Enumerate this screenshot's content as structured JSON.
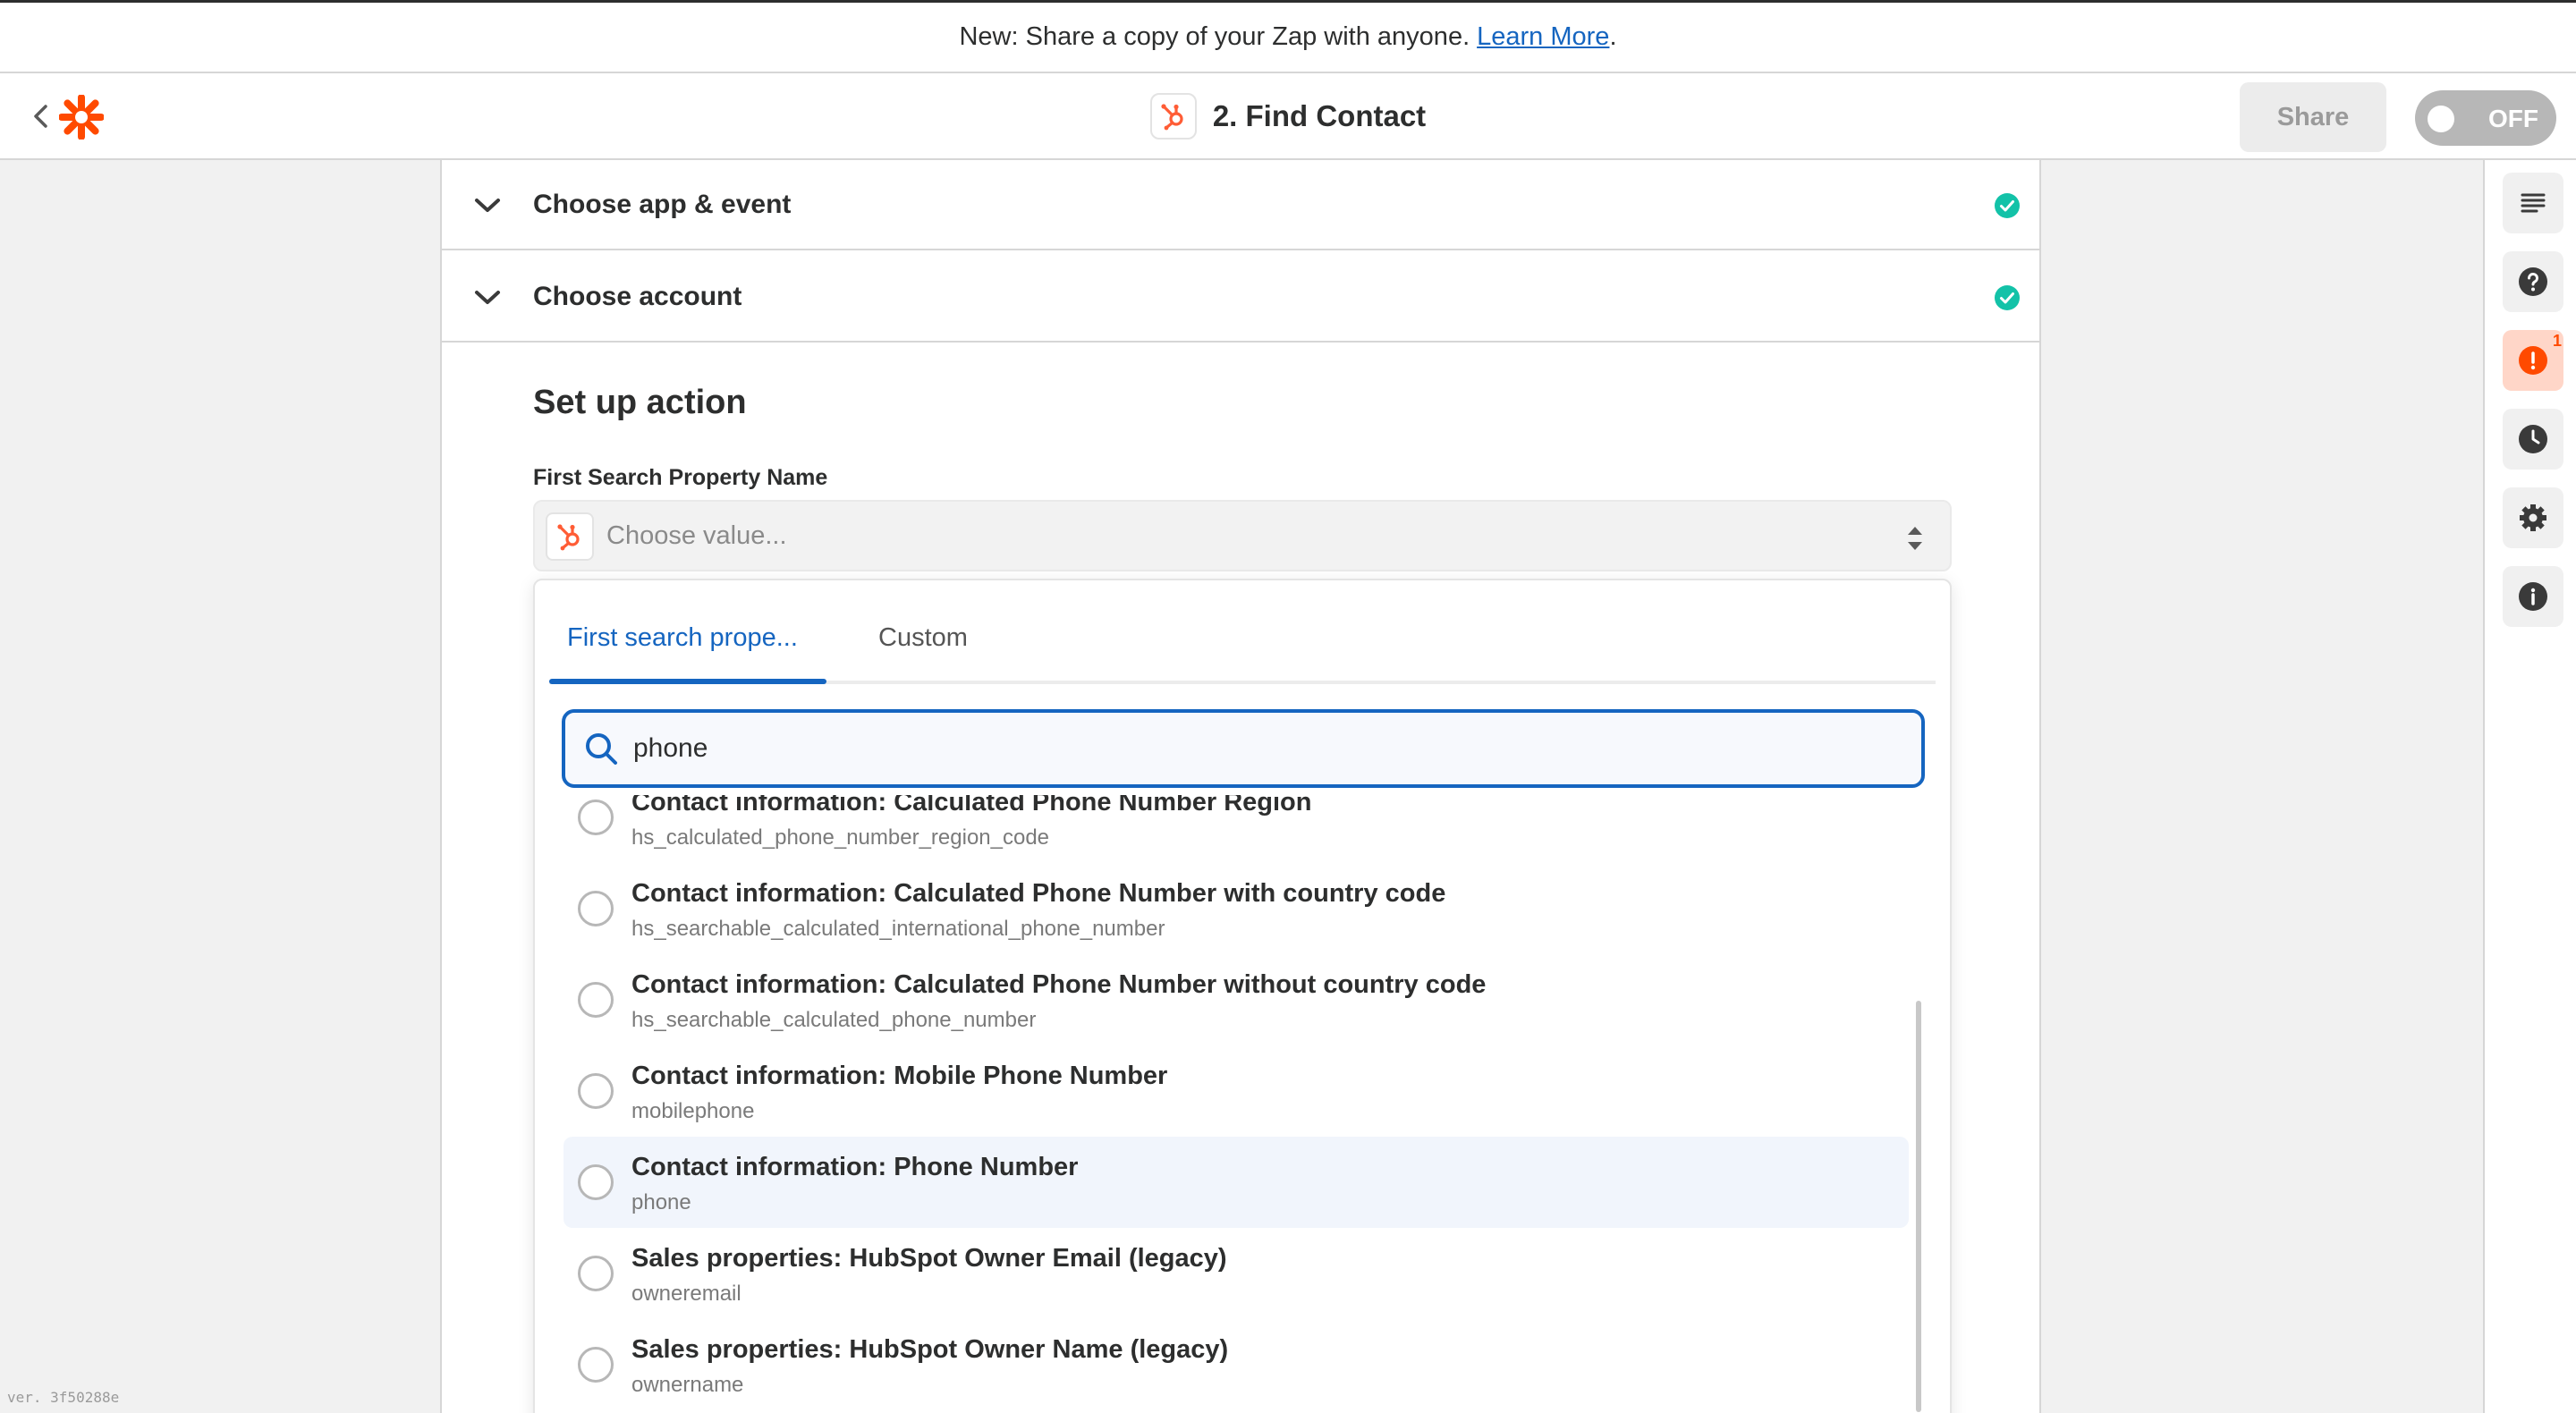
{
  "banner": {
    "text": "New: Share a copy of your Zap with anyone.",
    "link": "Learn More",
    "trail": "."
  },
  "header": {
    "title": "2. Find Contact",
    "share_label": "Share",
    "toggle_label": "OFF"
  },
  "steps": [
    {
      "label": "Choose app & event"
    },
    {
      "label": "Choose account"
    }
  ],
  "setup": {
    "title": "Set up action",
    "field_label": "First Search Property Name",
    "placeholder": "Choose value..."
  },
  "dropdown": {
    "tabs": [
      {
        "label": "First search prope..."
      },
      {
        "label": "Custom"
      }
    ],
    "search_value": "phone",
    "items": [
      {
        "title": "Contact information: Calculated Phone Number Region",
        "sub": "hs_calculated_phone_number_region_code"
      },
      {
        "title": "Contact information: Calculated Phone Number with country code",
        "sub": "hs_searchable_calculated_international_phone_number"
      },
      {
        "title": "Contact information: Calculated Phone Number without country code",
        "sub": "hs_searchable_calculated_phone_number"
      },
      {
        "title": "Contact information: Mobile Phone Number",
        "sub": "mobilephone"
      },
      {
        "title": "Contact information: Phone Number",
        "sub": "phone"
      },
      {
        "title": "Sales properties: HubSpot Owner Email (legacy)",
        "sub": "owneremail"
      },
      {
        "title": "Sales properties: HubSpot Owner Name (legacy)",
        "sub": "ownername"
      }
    ]
  },
  "sidebar": {
    "alert_count": "1"
  },
  "version": "ver. 3f50288e",
  "colors": {
    "brand": "#ff4a00",
    "accent": "#1565c0",
    "success": "#13c2a8"
  }
}
